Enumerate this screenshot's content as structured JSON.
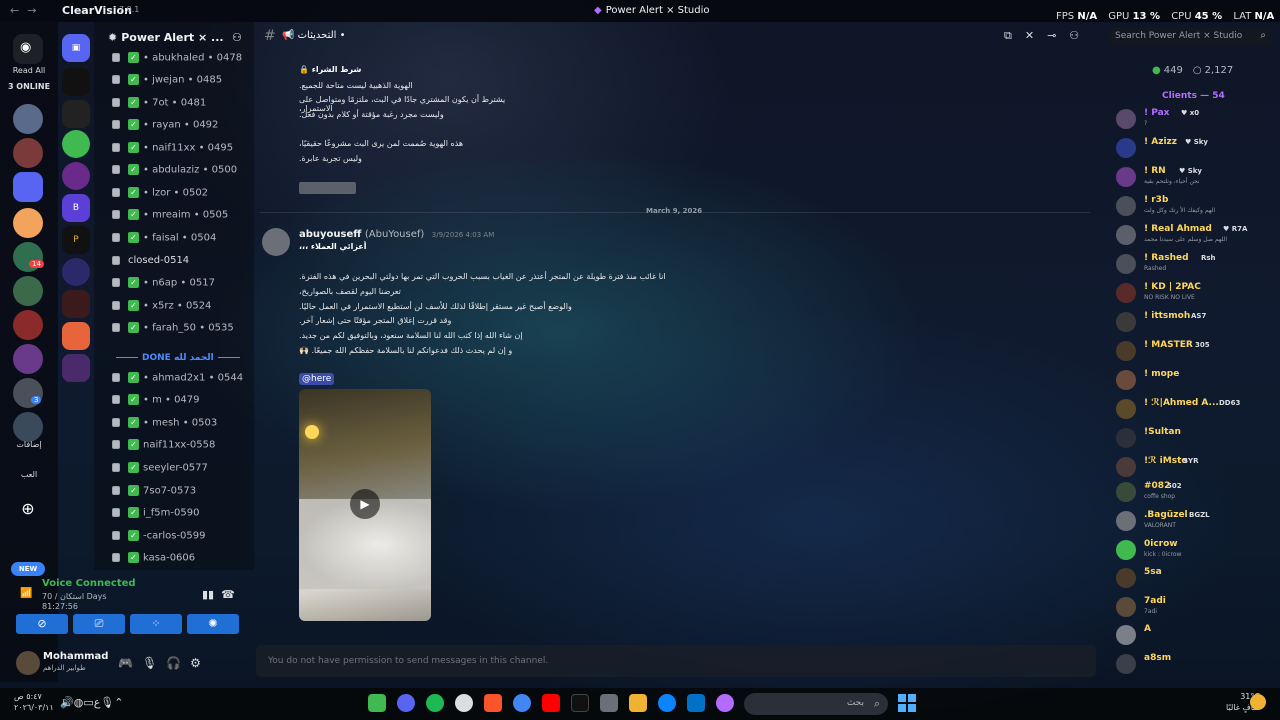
{
  "titlebar": {
    "app_name": "ClearVision",
    "version": "7.0.1",
    "window_title": "Power Alert × Studio",
    "stats": [
      {
        "label": "FPS",
        "value": "N/A"
      },
      {
        "label": "GPU",
        "value": "13 %"
      },
      {
        "label": "CPU",
        "value": "45 %"
      },
      {
        "label": "LAT",
        "value": "N/A"
      }
    ]
  },
  "rail": {
    "read_all": "Read All",
    "online": "3 ONLINE",
    "badges": [
      "9",
      "14",
      "3",
      "3"
    ],
    "label_a": "إضافات",
    "label_b": "العب",
    "new_label": "NEW"
  },
  "server": {
    "name": "Power Alert × ...",
    "channels": [
      {
        "name": "• abukhaled • 0478",
        "locked": true,
        "checked": true
      },
      {
        "name": "• jwejan • 0485",
        "locked": true,
        "checked": true
      },
      {
        "name": "• 7ot • 0481",
        "locked": true,
        "checked": true
      },
      {
        "name": "• rayan • 0492",
        "locked": true,
        "checked": true
      },
      {
        "name": "• naif11xx • 0495",
        "locked": true,
        "checked": true
      },
      {
        "name": "• abdulaziz • 0500",
        "locked": true,
        "checked": true
      },
      {
        "name": "• lzor • 0502",
        "locked": true,
        "checked": true
      },
      {
        "name": "• mreaim • 0505",
        "locked": true,
        "checked": true
      },
      {
        "name": "• faisal • 0504",
        "locked": true,
        "checked": true
      },
      {
        "name": "closed-0514",
        "locked": true,
        "checked": false
      },
      {
        "name": "• n6ap • 0517",
        "locked": true,
        "checked": true
      },
      {
        "name": "• x5rz • 0524",
        "locked": true,
        "checked": true
      },
      {
        "name": "• farah_50 • 0535",
        "locked": true,
        "checked": true
      }
    ],
    "category": "DONE الحمد لله",
    "channels_done": [
      {
        "name": "• ahmad2x1 • 0544",
        "locked": true,
        "checked": true
      },
      {
        "name": "• m • 0479",
        "locked": true,
        "checked": true
      },
      {
        "name": "• mesh • 0503",
        "locked": true,
        "checked": true
      },
      {
        "name": "naif11xx-0558",
        "locked": true,
        "checked": true
      },
      {
        "name": "seeyler-0577",
        "locked": true,
        "checked": true
      },
      {
        "name": "7so7-0573",
        "locked": true,
        "checked": true
      },
      {
        "name": "i_f5m-0590",
        "locked": true,
        "checked": true
      },
      {
        "name": "-carlos-0599",
        "locked": true,
        "checked": true
      },
      {
        "name": "kasa-0606",
        "locked": true,
        "checked": true
      }
    ]
  },
  "voice": {
    "status": "Voice Connected",
    "sub": "70 / استكان Days",
    "time": "81:27:56"
  },
  "user": {
    "name": "Mohammad",
    "status": "طوابير الدراهم"
  },
  "chat": {
    "channel_name": "التحديثات •",
    "search_placeholder": "Search Power Alert × Studio",
    "prev_message": {
      "heading": "شرط الشراء 🔒",
      "lines": [
        "الهوية الذهبية ليست متاحة للجميع.",
        "يشترط أن يكون المشتري جادًا في البث، ملتزمًا ومتواصل على الاستمرار،",
        "وليست مجرد رغبة مؤقتة أو كلام بدون فعل.",
        "",
        "هذه الهوية صُممت لمن يرى البث مشروعًا حقيقيًا،",
        "وليس تجربة عابرة."
      ]
    },
    "date_divider": "March 9, 2026",
    "message": {
      "author": "abuyouseff",
      "alias": "(AbuYousef)",
      "timestamp": "3/9/2026 4:03 AM",
      "greeting": "أعزائي العملاء ،،،",
      "lines": [
        "انا غائب منذ فترة طويلة عن المتجر أعتذر عن الغياب بسبب الحروب التي تمر بها دولتي البحرين في هذه الفترة.",
        "تعرضنا اليوم لقصف بالصواريخ،",
        "والوضع أصبح غير مستقر إطلاقًا لذلك للأسف لن أستطيع الاستمرار في العمل حاليًا.",
        "وقد قررت إغلاق المتجر مؤقتًا حتى إشعار آخر.",
        "إن شاء الله إذا كتب الله لنا السلامة سنعود، وبالتوفيق لكم من جديد.",
        "و إن لم يحدث ذلك فدعواتكم لنا بالسلامة حفظكم الله جميعًا. 🙌🏻"
      ],
      "mention": "@here"
    },
    "composer_placeholder": "You do not have permission to send messages in this channel."
  },
  "members": {
    "online_count": "449",
    "total_count": "2,127",
    "header": "Clients — 54",
    "list": [
      {
        "name": "! Pax",
        "tag": "♥ x0",
        "sub": "?",
        "color": "#b36cff"
      },
      {
        "name": "! Azizz",
        "tag": "♥ Sky",
        "sub": "",
        "color": "#ffd75a"
      },
      {
        "name": "! RN",
        "tag": "♥ Sky",
        "sub": "نحن أحياء، ونلتحم بقية",
        "color": "#ffd75a"
      },
      {
        "name": "! r3b",
        "tag": "",
        "sub": "الهم وكيفك الأ رتك وكل ولت",
        "color": "#ffd75a"
      },
      {
        "name": "! Real Ahmad",
        "tag": "♥ R7A",
        "sub": "اللهم صل وسلم على سيدنا محمد",
        "color": "#ffd75a"
      },
      {
        "name": "! Rashed",
        "tag": "Rsh",
        "sub": "Rashed",
        "color": "#ffd75a"
      },
      {
        "name": "! KD | 2PAC",
        "tag": "",
        "sub": "NO RISK NO LIVE",
        "color": "#ffd75a"
      },
      {
        "name": "! ittsmoh",
        "tag": "AS7",
        "sub": "",
        "color": "#ffd75a"
      },
      {
        "name": "! MASTER",
        "tag": "305",
        "sub": "",
        "color": "#ffd75a"
      },
      {
        "name": "! mope",
        "tag": "",
        "sub": "",
        "color": "#ffd75a"
      },
      {
        "name": "! ℛ|Ahmed A...",
        "tag": "DD63",
        "sub": "",
        "color": "#ffd75a"
      },
      {
        "name": "!Sultan",
        "tag": "",
        "sub": "",
        "color": "#ffd75a"
      },
      {
        "name": "!ℛ iMsto",
        "tag": "SYR",
        "sub": "",
        "color": "#ffd75a"
      },
      {
        "name": "#082",
        "tag": "502",
        "sub": "coffe shop",
        "color": "#ffd75a"
      },
      {
        "name": ".Bagüzel",
        "tag": "BGZL",
        "sub": "VALORANT",
        "color": "#ffd75a"
      },
      {
        "name": "0icrow",
        "tag": "",
        "sub": "kick : 0icrow",
        "color": "#ffd75a"
      },
      {
        "name": "5sa",
        "tag": "",
        "sub": "",
        "color": "#ffd75a"
      },
      {
        "name": "7adi",
        "tag": "",
        "sub": "7adi",
        "color": "#ffd75a"
      },
      {
        "name": "A",
        "tag": "",
        "sub": "",
        "color": "#ffd75a"
      },
      {
        "name": "a8sm",
        "tag": "",
        "sub": "",
        "color": "#ffd75a"
      }
    ]
  },
  "taskbar": {
    "time": "٥:٤٧ ص",
    "date": "٢٠٢٦/٠٣/١١",
    "lang": "ع",
    "search_text": "بحث",
    "temperature": "31°C",
    "weather": "صافٍ غالبًا"
  }
}
